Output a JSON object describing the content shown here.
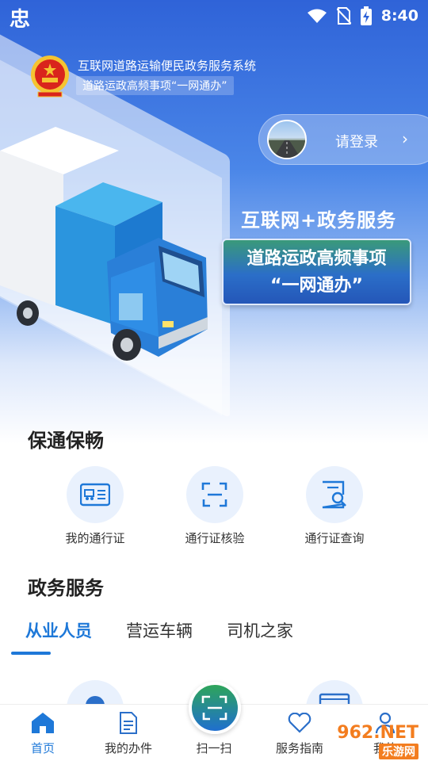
{
  "status_bar": {
    "app_icon": "忠",
    "time": "8:40",
    "icons": [
      "wifi-icon",
      "no-sim-icon",
      "battery-charging-icon"
    ]
  },
  "header": {
    "title": "互联网道路运输便民政务服务系统",
    "subtitle": "道路运政高频事项“一网通办”",
    "emblem_icon": "national-emblem-icon"
  },
  "login": {
    "label": "请登录",
    "chevron": "›"
  },
  "hero": {
    "slogan_line1": "互联网+政务服务",
    "slogan_box_line1": "道路运政高频事项",
    "slogan_box_line2": "“一网通办”"
  },
  "section_baotong": {
    "title": "保通保畅",
    "items": [
      {
        "label": "我的通行证",
        "icon": "pass-card-icon"
      },
      {
        "label": "通行证核验",
        "icon": "scan-verify-icon"
      },
      {
        "label": "通行证查询",
        "icon": "document-search-icon"
      }
    ]
  },
  "section_zhengwu": {
    "title": "政务服务",
    "tabs": [
      {
        "label": "从业人员",
        "active": true
      },
      {
        "label": "营运车辆",
        "active": false
      },
      {
        "label": "司机之家",
        "active": false
      }
    ]
  },
  "bottom_nav": {
    "items": [
      {
        "label": "首页",
        "icon": "home-icon",
        "active": true
      },
      {
        "label": "我的办件",
        "icon": "document-icon",
        "active": false
      },
      {
        "label": "扫一扫",
        "icon": "scan-icon",
        "active": false
      },
      {
        "label": "服务指南",
        "icon": "heart-icon",
        "active": false
      },
      {
        "label": "我的",
        "icon": "user-icon",
        "active": false
      }
    ]
  },
  "watermark": {
    "text": "962.NET",
    "sub": "乐游网"
  },
  "colors": {
    "accent": "#1e78d8",
    "hero_top": "#2f63d8",
    "icon_bg": "#e9f1fd",
    "watermark": "#f37d1f"
  }
}
